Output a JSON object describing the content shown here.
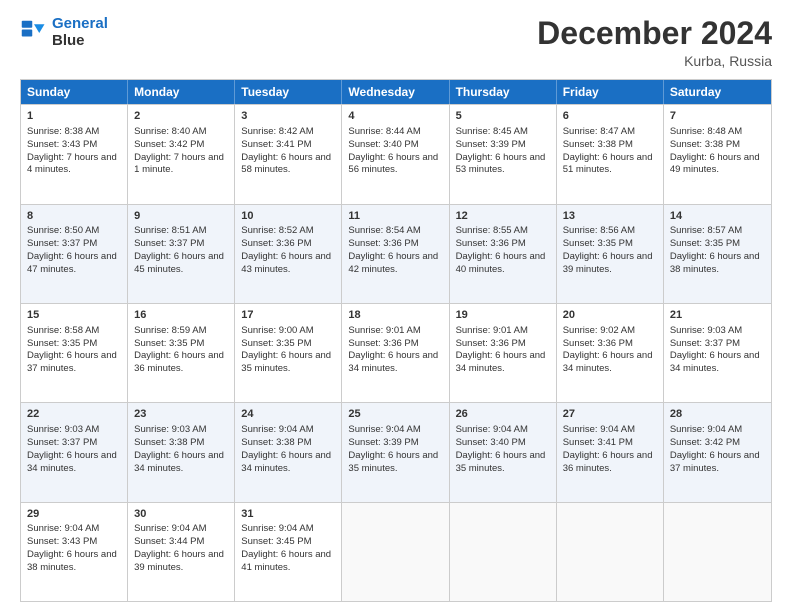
{
  "logo": {
    "line1": "General",
    "line2": "Blue"
  },
  "title": "December 2024",
  "location": "Kurba, Russia",
  "days_of_week": [
    "Sunday",
    "Monday",
    "Tuesday",
    "Wednesday",
    "Thursday",
    "Friday",
    "Saturday"
  ],
  "weeks": [
    [
      {
        "day": "1",
        "sunrise": "Sunrise: 8:38 AM",
        "sunset": "Sunset: 3:43 PM",
        "daylight": "Daylight: 7 hours and 4 minutes."
      },
      {
        "day": "2",
        "sunrise": "Sunrise: 8:40 AM",
        "sunset": "Sunset: 3:42 PM",
        "daylight": "Daylight: 7 hours and 1 minute."
      },
      {
        "day": "3",
        "sunrise": "Sunrise: 8:42 AM",
        "sunset": "Sunset: 3:41 PM",
        "daylight": "Daylight: 6 hours and 58 minutes."
      },
      {
        "day": "4",
        "sunrise": "Sunrise: 8:44 AM",
        "sunset": "Sunset: 3:40 PM",
        "daylight": "Daylight: 6 hours and 56 minutes."
      },
      {
        "day": "5",
        "sunrise": "Sunrise: 8:45 AM",
        "sunset": "Sunset: 3:39 PM",
        "daylight": "Daylight: 6 hours and 53 minutes."
      },
      {
        "day": "6",
        "sunrise": "Sunrise: 8:47 AM",
        "sunset": "Sunset: 3:38 PM",
        "daylight": "Daylight: 6 hours and 51 minutes."
      },
      {
        "day": "7",
        "sunrise": "Sunrise: 8:48 AM",
        "sunset": "Sunset: 3:38 PM",
        "daylight": "Daylight: 6 hours and 49 minutes."
      }
    ],
    [
      {
        "day": "8",
        "sunrise": "Sunrise: 8:50 AM",
        "sunset": "Sunset: 3:37 PM",
        "daylight": "Daylight: 6 hours and 47 minutes."
      },
      {
        "day": "9",
        "sunrise": "Sunrise: 8:51 AM",
        "sunset": "Sunset: 3:37 PM",
        "daylight": "Daylight: 6 hours and 45 minutes."
      },
      {
        "day": "10",
        "sunrise": "Sunrise: 8:52 AM",
        "sunset": "Sunset: 3:36 PM",
        "daylight": "Daylight: 6 hours and 43 minutes."
      },
      {
        "day": "11",
        "sunrise": "Sunrise: 8:54 AM",
        "sunset": "Sunset: 3:36 PM",
        "daylight": "Daylight: 6 hours and 42 minutes."
      },
      {
        "day": "12",
        "sunrise": "Sunrise: 8:55 AM",
        "sunset": "Sunset: 3:36 PM",
        "daylight": "Daylight: 6 hours and 40 minutes."
      },
      {
        "day": "13",
        "sunrise": "Sunrise: 8:56 AM",
        "sunset": "Sunset: 3:35 PM",
        "daylight": "Daylight: 6 hours and 39 minutes."
      },
      {
        "day": "14",
        "sunrise": "Sunrise: 8:57 AM",
        "sunset": "Sunset: 3:35 PM",
        "daylight": "Daylight: 6 hours and 38 minutes."
      }
    ],
    [
      {
        "day": "15",
        "sunrise": "Sunrise: 8:58 AM",
        "sunset": "Sunset: 3:35 PM",
        "daylight": "Daylight: 6 hours and 37 minutes."
      },
      {
        "day": "16",
        "sunrise": "Sunrise: 8:59 AM",
        "sunset": "Sunset: 3:35 PM",
        "daylight": "Daylight: 6 hours and 36 minutes."
      },
      {
        "day": "17",
        "sunrise": "Sunrise: 9:00 AM",
        "sunset": "Sunset: 3:35 PM",
        "daylight": "Daylight: 6 hours and 35 minutes."
      },
      {
        "day": "18",
        "sunrise": "Sunrise: 9:01 AM",
        "sunset": "Sunset: 3:36 PM",
        "daylight": "Daylight: 6 hours and 34 minutes."
      },
      {
        "day": "19",
        "sunrise": "Sunrise: 9:01 AM",
        "sunset": "Sunset: 3:36 PM",
        "daylight": "Daylight: 6 hours and 34 minutes."
      },
      {
        "day": "20",
        "sunrise": "Sunrise: 9:02 AM",
        "sunset": "Sunset: 3:36 PM",
        "daylight": "Daylight: 6 hours and 34 minutes."
      },
      {
        "day": "21",
        "sunrise": "Sunrise: 9:03 AM",
        "sunset": "Sunset: 3:37 PM",
        "daylight": "Daylight: 6 hours and 34 minutes."
      }
    ],
    [
      {
        "day": "22",
        "sunrise": "Sunrise: 9:03 AM",
        "sunset": "Sunset: 3:37 PM",
        "daylight": "Daylight: 6 hours and 34 minutes."
      },
      {
        "day": "23",
        "sunrise": "Sunrise: 9:03 AM",
        "sunset": "Sunset: 3:38 PM",
        "daylight": "Daylight: 6 hours and 34 minutes."
      },
      {
        "day": "24",
        "sunrise": "Sunrise: 9:04 AM",
        "sunset": "Sunset: 3:38 PM",
        "daylight": "Daylight: 6 hours and 34 minutes."
      },
      {
        "day": "25",
        "sunrise": "Sunrise: 9:04 AM",
        "sunset": "Sunset: 3:39 PM",
        "daylight": "Daylight: 6 hours and 35 minutes."
      },
      {
        "day": "26",
        "sunrise": "Sunrise: 9:04 AM",
        "sunset": "Sunset: 3:40 PM",
        "daylight": "Daylight: 6 hours and 35 minutes."
      },
      {
        "day": "27",
        "sunrise": "Sunrise: 9:04 AM",
        "sunset": "Sunset: 3:41 PM",
        "daylight": "Daylight: 6 hours and 36 minutes."
      },
      {
        "day": "28",
        "sunrise": "Sunrise: 9:04 AM",
        "sunset": "Sunset: 3:42 PM",
        "daylight": "Daylight: 6 hours and 37 minutes."
      }
    ],
    [
      {
        "day": "29",
        "sunrise": "Sunrise: 9:04 AM",
        "sunset": "Sunset: 3:43 PM",
        "daylight": "Daylight: 6 hours and 38 minutes."
      },
      {
        "day": "30",
        "sunrise": "Sunrise: 9:04 AM",
        "sunset": "Sunset: 3:44 PM",
        "daylight": "Daylight: 6 hours and 39 minutes."
      },
      {
        "day": "31",
        "sunrise": "Sunrise: 9:04 AM",
        "sunset": "Sunset: 3:45 PM",
        "daylight": "Daylight: 6 hours and 41 minutes."
      },
      null,
      null,
      null,
      null
    ]
  ]
}
